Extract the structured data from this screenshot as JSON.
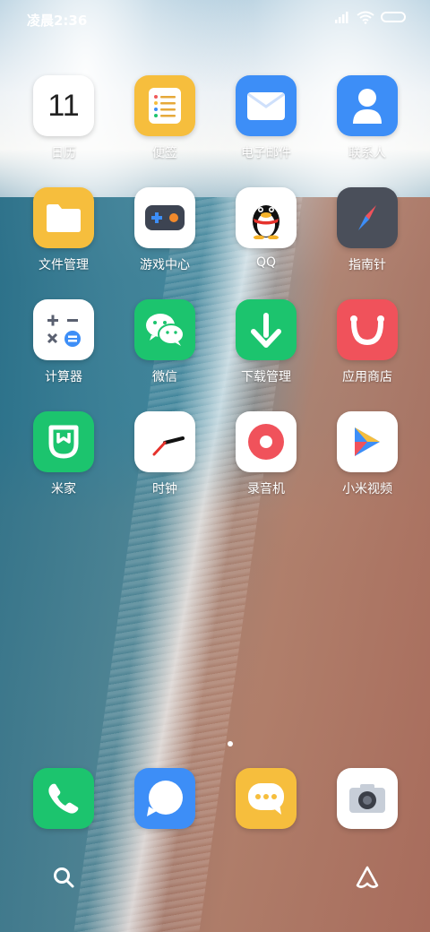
{
  "status_bar": {
    "time": "凌晨2:36"
  },
  "apps": {
    "calendar": {
      "label": "日历",
      "day": "11"
    },
    "notes": {
      "label": "便签"
    },
    "email": {
      "label": "电子邮件"
    },
    "contacts": {
      "label": "联系人"
    },
    "files": {
      "label": "文件管理"
    },
    "games": {
      "label": "游戏中心"
    },
    "qq": {
      "label": "QQ"
    },
    "compass": {
      "label": "指南针"
    },
    "calculator": {
      "label": "计算器"
    },
    "wechat": {
      "label": "微信"
    },
    "downloads": {
      "label": "下载管理"
    },
    "appstore": {
      "label": "应用商店"
    },
    "mihome": {
      "label": "米家"
    },
    "clock": {
      "label": "时钟"
    },
    "recorder": {
      "label": "录音机"
    },
    "mivideo": {
      "label": "小米视频"
    }
  },
  "dock": {
    "phone": "phone-app",
    "messages": "messages-app",
    "browser": "chat-bubble-app",
    "camera": "camera-app"
  },
  "icons": {
    "search": "search-icon",
    "assistant": "assistant-icon"
  },
  "colors": {
    "blue": "#3d8ef7",
    "yellow": "#f6be3d",
    "green": "#1cc46e",
    "red": "#f0525b",
    "dark": "#4a4f5a"
  }
}
